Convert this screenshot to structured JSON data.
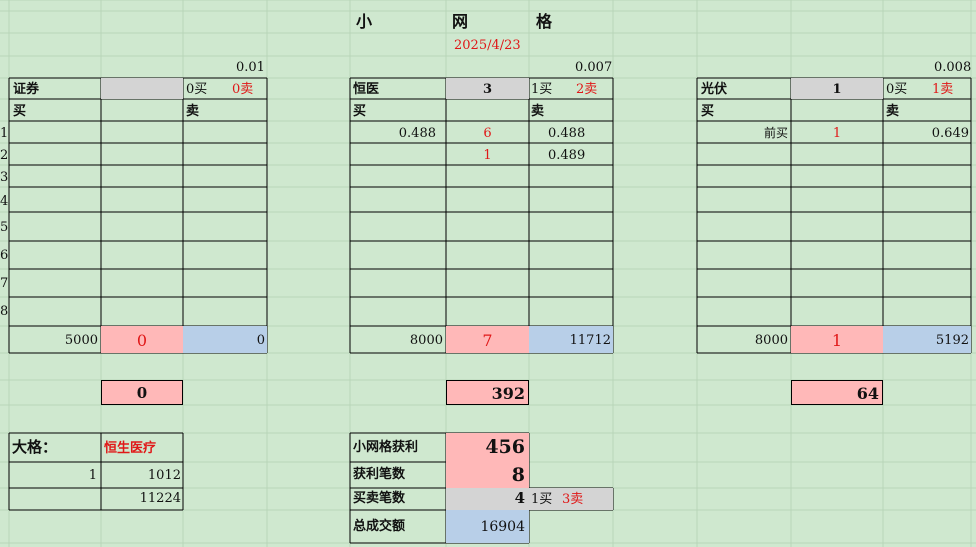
{
  "header": {
    "title_1": "小",
    "title_2": "网",
    "title_3": "格",
    "date": "2025/4/23"
  },
  "row_labels": [
    "1",
    "2",
    "3",
    "4",
    "5",
    "6",
    "7",
    "8"
  ],
  "panels": {
    "securities": {
      "step": "0.01",
      "name": "证券",
      "count": "",
      "buy_badge": "0买",
      "sell_badge": "0卖",
      "col_buy": "买",
      "col_sell": "卖",
      "base": "5000",
      "trades": "0",
      "amount": "0",
      "profit": "0"
    },
    "healthcare": {
      "step": "0.007",
      "name": "恒医",
      "count": "3",
      "buy_badge": "1买",
      "sell_badge": "2卖",
      "col_buy": "买",
      "col_sell": "卖",
      "row1_buy": "0.488",
      "row1_qty": "6",
      "row1_sell": "0.488",
      "row2_qty": "1",
      "row2_sell": "0.489",
      "base": "8000",
      "trades": "7",
      "amount": "11712",
      "profit": "392"
    },
    "solar": {
      "step": "0.008",
      "name": "光伏",
      "count": "1",
      "buy_badge": "0买",
      "sell_badge": "1卖",
      "col_buy": "买",
      "col_sell": "卖",
      "row1_label": "前买",
      "row1_qty": "1",
      "row1_sell": "0.649",
      "base": "8000",
      "trades": "1",
      "amount": "5192",
      "profit": "64"
    }
  },
  "big_grid": {
    "label": "大格：",
    "name": "恒生医疗",
    "count": "1",
    "value1": "1012",
    "value2": "11224"
  },
  "summary": {
    "profit_label": "小网格获利",
    "profit": "456",
    "wins_label": "获利笔数",
    "wins": "8",
    "trades_label": "买卖笔数",
    "trades": "4",
    "buy_badge": "1买",
    "sell_badge": "3卖",
    "volume_label": "总成交额",
    "volume": "16904"
  },
  "colors": {
    "background": "#cfe8cf",
    "grid_line": "#b9d6b9",
    "pink": "#ffb8b8",
    "blue": "#b8cfe8",
    "grey": "#d4d4d4",
    "red": "#e01818"
  }
}
